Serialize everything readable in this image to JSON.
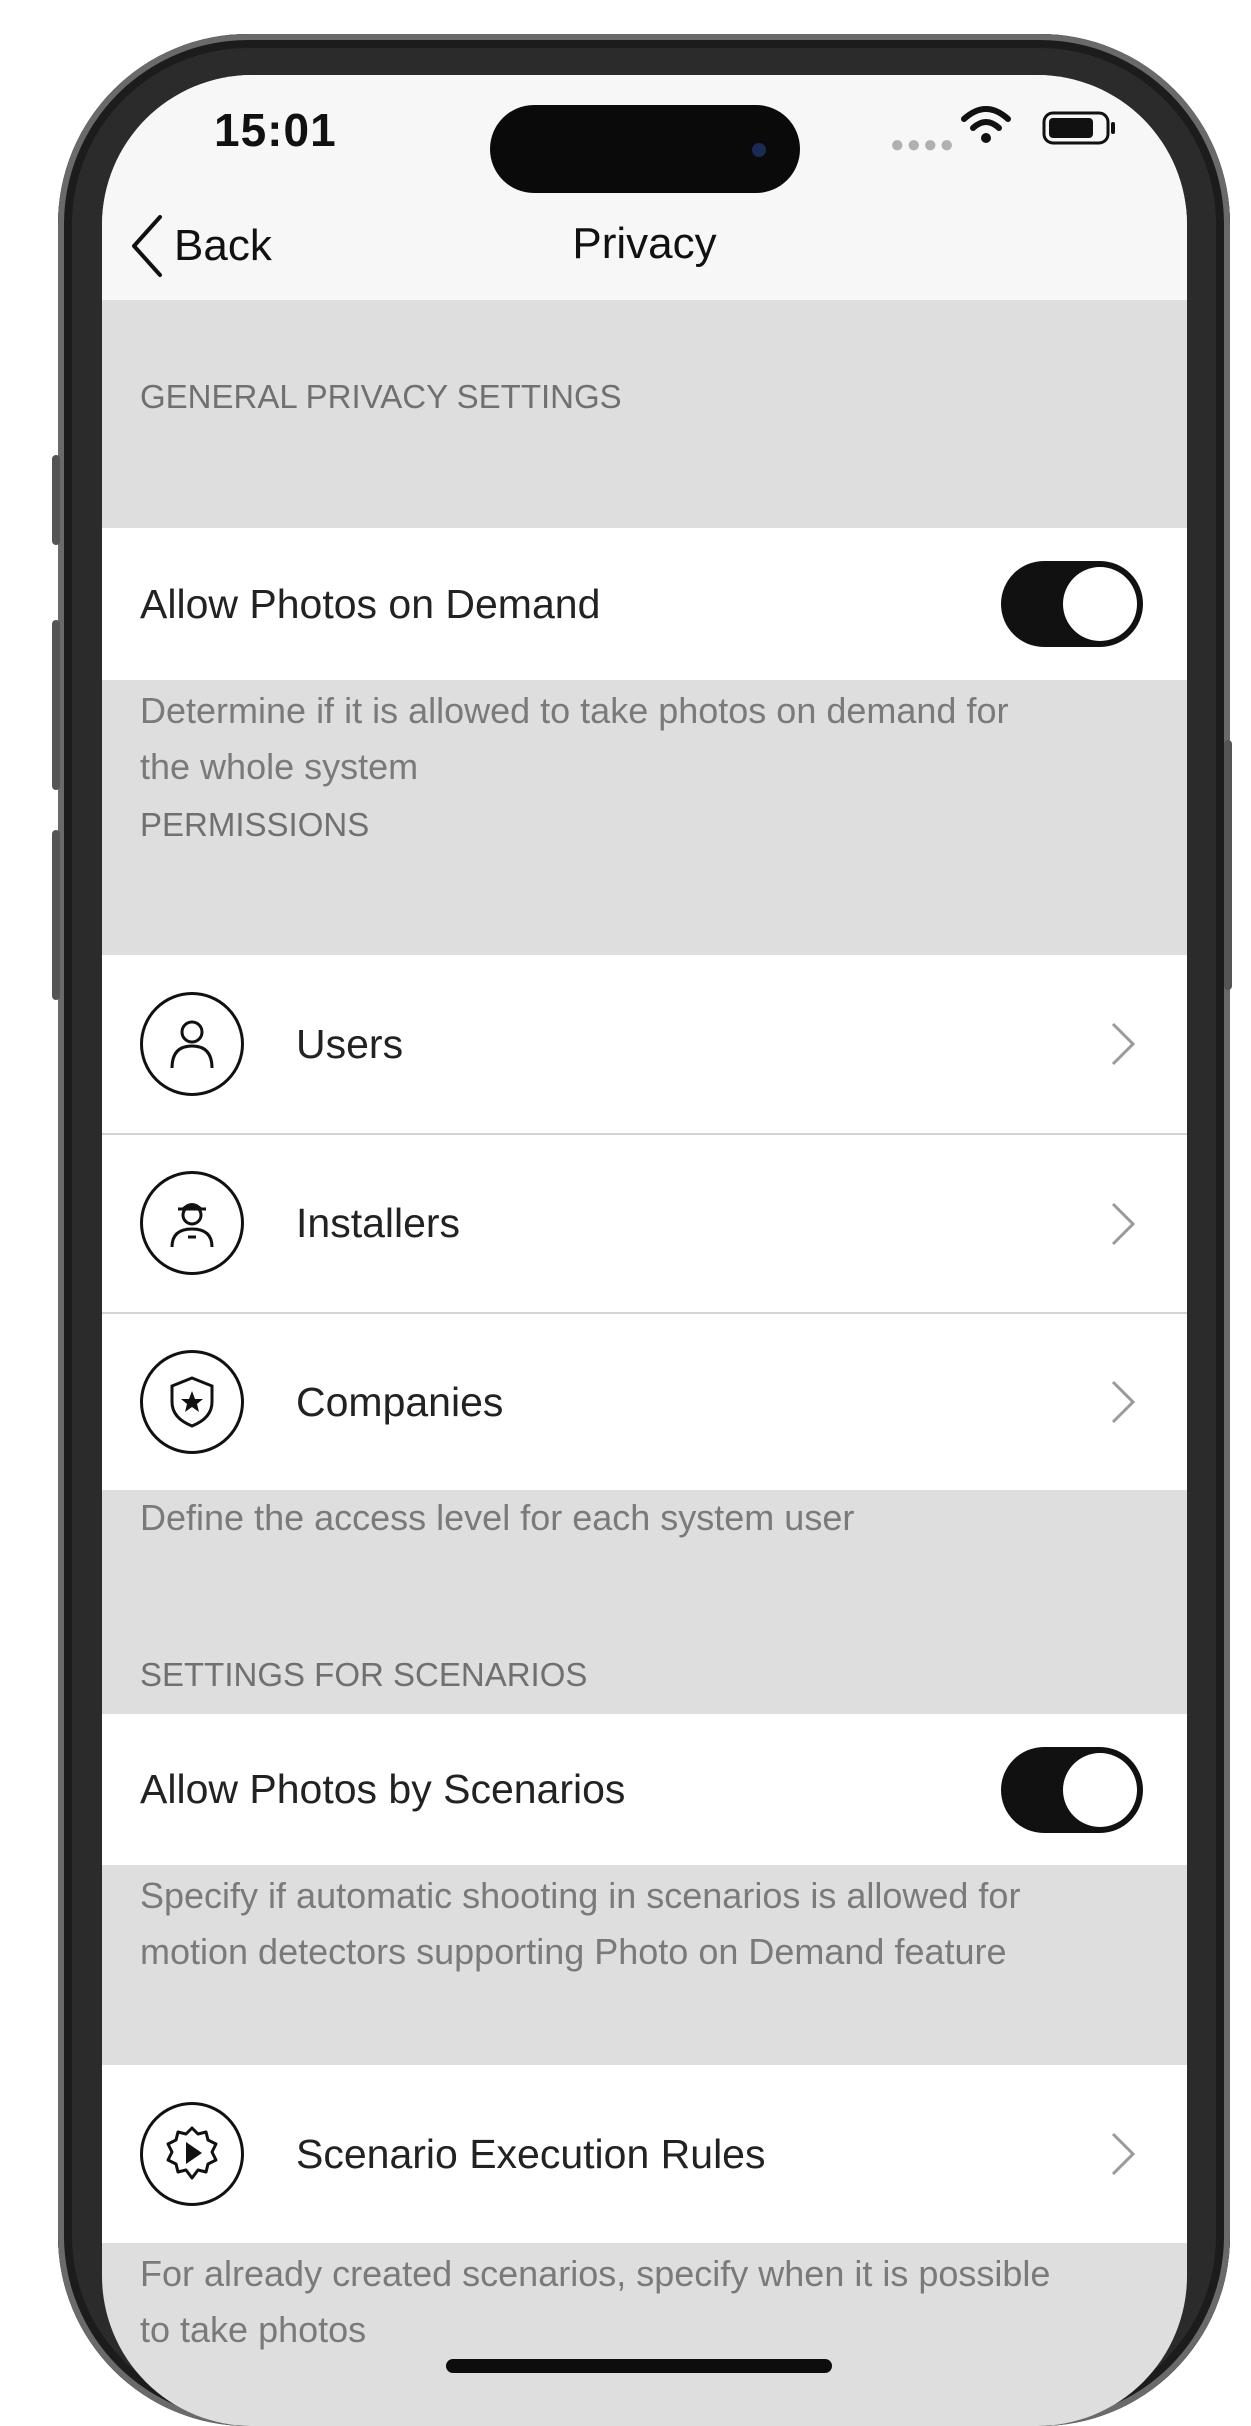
{
  "status_bar": {
    "time": "15:01"
  },
  "nav": {
    "back_label": "Back",
    "title": "Privacy"
  },
  "general": {
    "header": "GENERAL PRIVACY SETTINGS",
    "toggle_label": "Allow Photos on Demand",
    "toggle_on": true,
    "footnote_line1": "Determine if it is allowed to take photos on demand for",
    "footnote_line2": "the whole system"
  },
  "permissions": {
    "header": "PERMISSIONS",
    "items": [
      {
        "label": "Users",
        "icon": "user-icon"
      },
      {
        "label": "Installers",
        "icon": "installer-icon"
      },
      {
        "label": "Companies",
        "icon": "shield-star-icon"
      }
    ],
    "footnote": "Define the access level for each system user"
  },
  "scenarios": {
    "header": "SETTINGS FOR SCENARIOS",
    "toggle_label": "Allow Photos by Scenarios",
    "toggle_on": true,
    "footnote_line1": "Specify if automatic shooting in scenarios is allowed for",
    "footnote_line2": "motion detectors supporting Photo on Demand feature"
  },
  "rules": {
    "label": "Scenario Execution Rules",
    "icon": "gear-play-icon",
    "footnote_line1": "For already created scenarios, specify when it is possible",
    "footnote_line2": "to take photos"
  },
  "colors": {
    "toggle_on": "#111111",
    "background": "#dedede"
  }
}
